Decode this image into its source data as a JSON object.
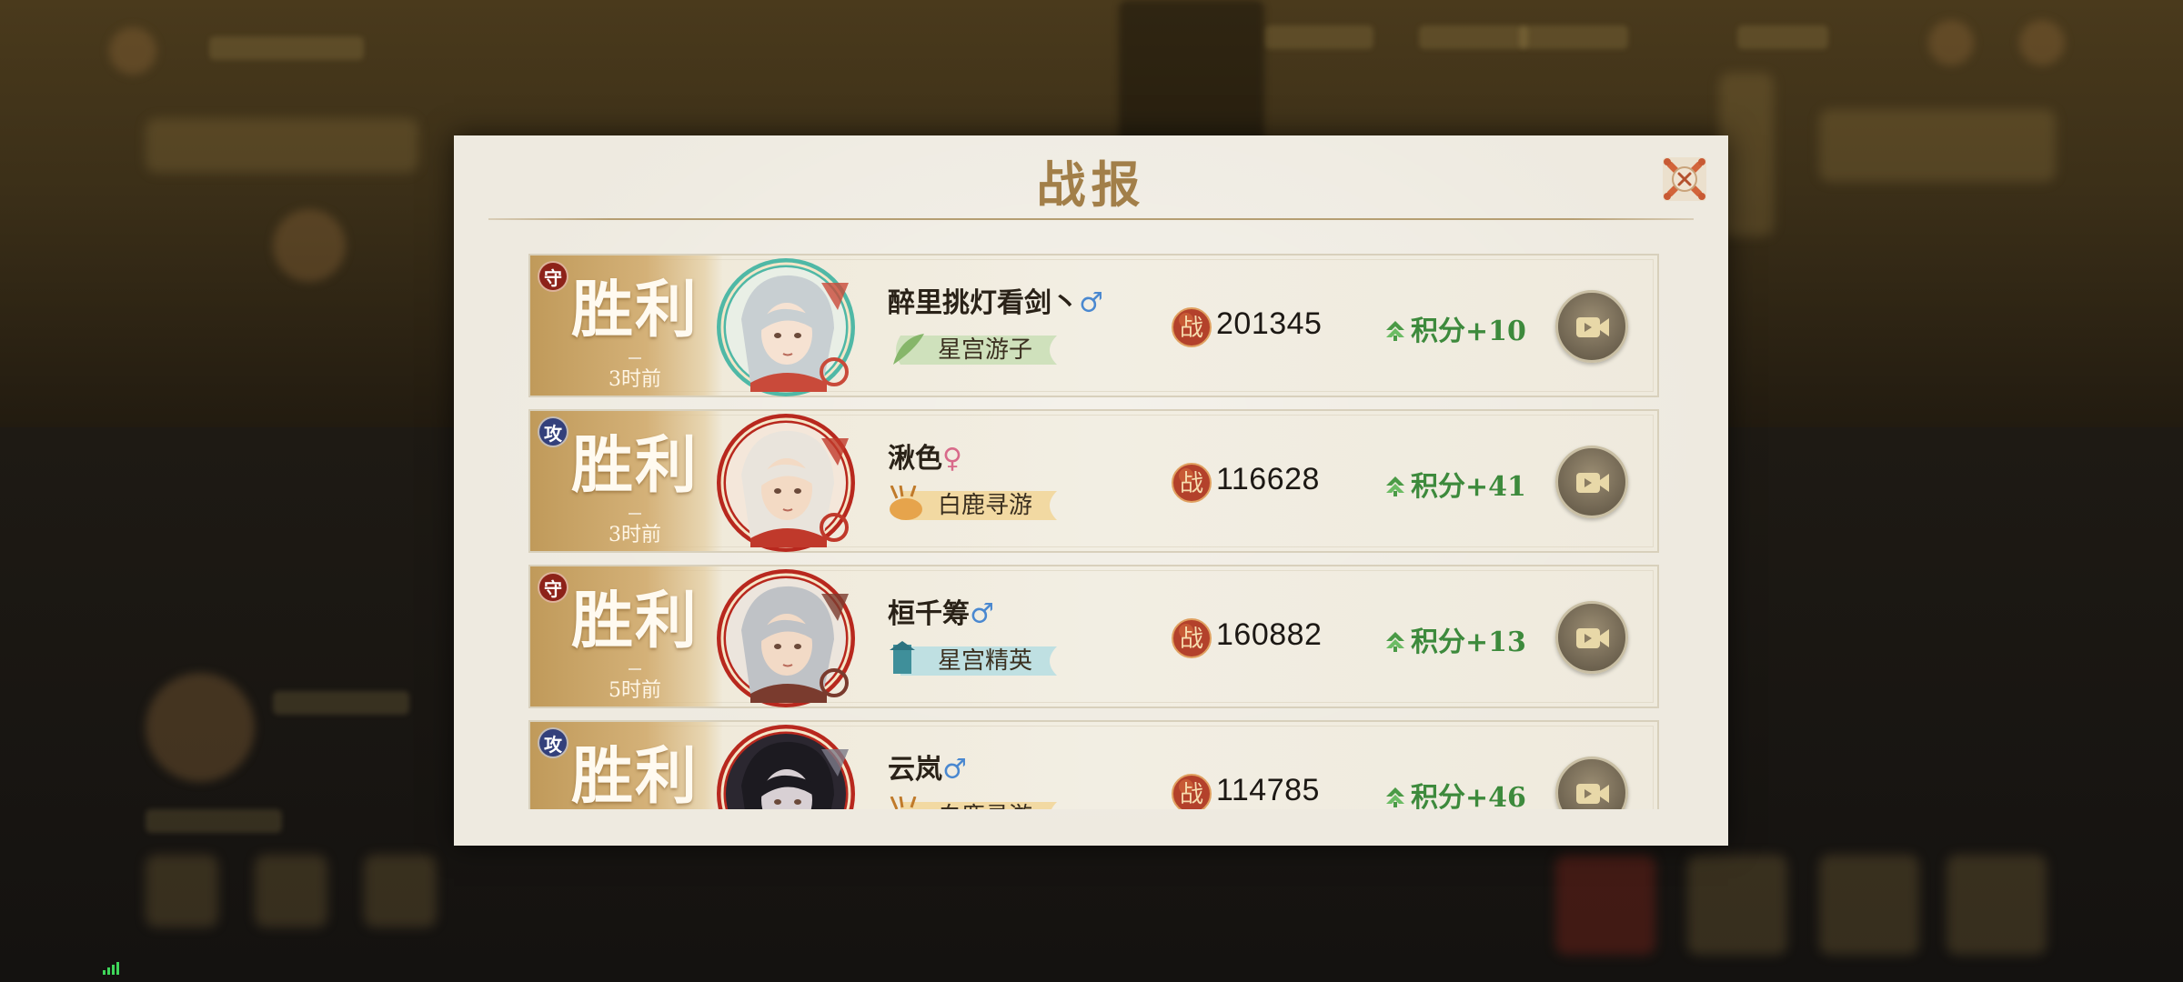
{
  "dialog": {
    "title": "战报"
  },
  "reports": [
    {
      "role": "守",
      "role_type": "defense",
      "result": "胜利",
      "time": "3时前",
      "name": "醉里挑灯看剑丶",
      "gender": "♂",
      "gender_type": "male",
      "title": "星宫游子",
      "title_style": "leaf-green",
      "power": "201345",
      "power_label": "战",
      "score": "积分+10"
    },
    {
      "role": "攻",
      "role_type": "attack",
      "result": "胜利",
      "time": "3时前",
      "name": "湫色",
      "gender": "♀",
      "gender_type": "female",
      "title": "白鹿寻游",
      "title_style": "deer-gold",
      "power": "116628",
      "power_label": "战",
      "score": "积分+41"
    },
    {
      "role": "守",
      "role_type": "defense",
      "result": "胜利",
      "time": "5时前",
      "name": "桓千筹",
      "gender": "♂",
      "gender_type": "male",
      "title": "星宫精英",
      "title_style": "tower-teal",
      "power": "160882",
      "power_label": "战",
      "score": "积分+13"
    },
    {
      "role": "攻",
      "role_type": "attack",
      "result": "胜利",
      "time": "",
      "name": "云岚",
      "gender": "♂",
      "gender_type": "male",
      "title": "白鹿寻游",
      "title_style": "deer-gold",
      "power": "114785",
      "power_label": "战",
      "score": "积分+46"
    }
  ],
  "colors": {
    "dialog_bg": "#eeeae0",
    "title_gold": "#a27f49",
    "result_panel": "#c09a5a",
    "defense_badge": "#8d2219",
    "attack_badge": "#33407b",
    "score_green": "#3d8a3c",
    "male_blue": "#4a88d0",
    "female_pink": "#d86a8a"
  },
  "icons": {
    "close": "close-icon",
    "power": "battle-power-icon",
    "score": "arrow-up-icon",
    "replay": "video-replay-icon",
    "signal": "signal-icon"
  }
}
